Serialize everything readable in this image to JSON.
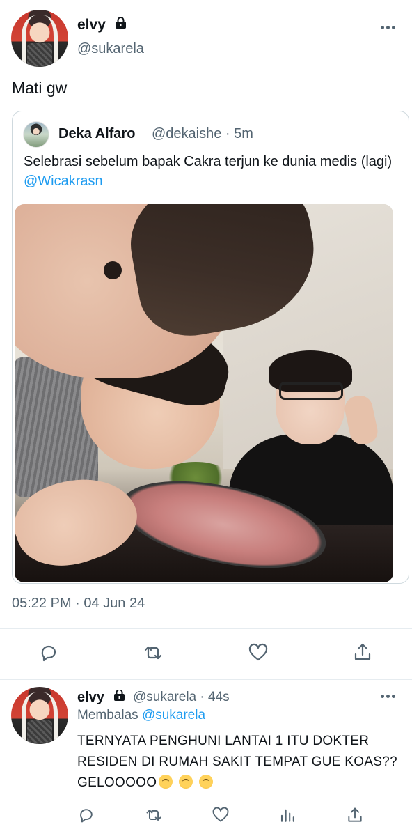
{
  "main_tweet": {
    "name": "elvy",
    "handle": "@sukarela",
    "text": "Mati gw",
    "quote": {
      "name": "Deka Alfaro",
      "handle": "@dekaishe · 5m",
      "text": "Selebrasi sebelum bapak Cakra terjun ke dunia medis (lagi)",
      "mention": "@Wicakrasn"
    },
    "timestamp": "05:22 PM · 04 Jun 24",
    "actions": [
      "reply-icon",
      "retweet-icon",
      "like-icon",
      "share-icon"
    ]
  },
  "reply": {
    "name": "elvy",
    "handle": "@sukarela · 44s",
    "reply_prefix": "Membalas",
    "reply_to": "@sukarela",
    "text": "TERNYATA PENGHUNI LANTAI 1 ITU DOKTER RESIDEN DI RUMAH SAKIT TEMPAT GUE KOAS?? GELOOOOO",
    "emojis": [
      "loudly-crying-face",
      "loudly-crying-face",
      "loudly-crying-face"
    ],
    "actions": [
      "reply-icon",
      "retweet-icon",
      "like-icon",
      "analytics-icon",
      "share-icon"
    ]
  },
  "colors": {
    "text": "#0f1419",
    "secondary": "#536471",
    "link": "#1d9bf0",
    "border": "#cfd9de"
  }
}
